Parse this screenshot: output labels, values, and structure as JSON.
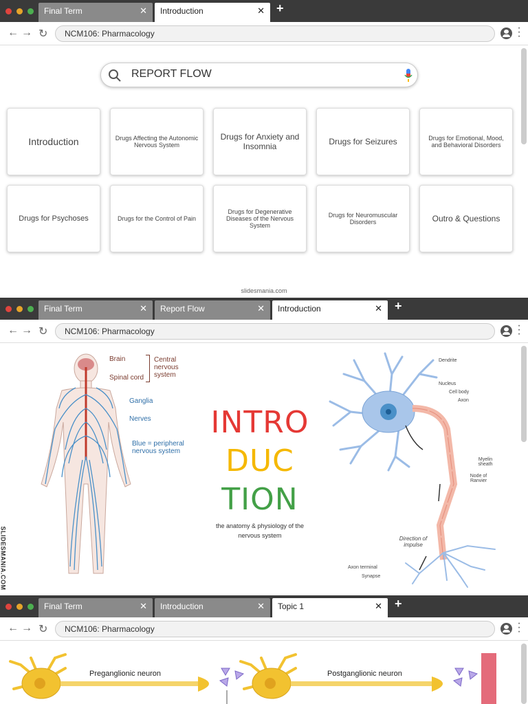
{
  "windows": [
    {
      "tabs": [
        {
          "label": "Final Term",
          "active": false
        },
        {
          "label": "Introduction",
          "active": true
        }
      ],
      "url": "NCM106: Pharmacology",
      "search_text": "REPORT FLOW",
      "cards": [
        "Introduction",
        "Drugs Affecting the Autonomic Nervous System",
        "Drugs for Anxiety and Insomnia",
        "Drugs for Seizures",
        "Drugs for Emotional, Mood, and Behavioral Disorders",
        "Drugs for Psychoses",
        "Drugs for the Control of Pain",
        "Drugs for Degenerative Diseases of the Nervous System",
        "Drugs for Neuromuscular Disorders",
        "Outro & Questions"
      ],
      "footer": "slidesmania.com"
    },
    {
      "tabs": [
        {
          "label": "Final Term",
          "active": false
        },
        {
          "label": "Report Flow",
          "active": false
        },
        {
          "label": "Introduction",
          "active": true
        }
      ],
      "url": "NCM106: Pharmacology",
      "title_lines": [
        "INTRO",
        "DUC",
        "TION"
      ],
      "subtitle": "the anatomy & physiology of the nervous system",
      "watermark": "SLIDESMANIA.COM",
      "body_labels": {
        "brain": "Brain",
        "spinal_cord": "Spinal cord",
        "cns": "Central nervous system",
        "ganglia": "Ganglia",
        "nerves": "Nerves",
        "blue": "Blue = peripheral nervous system"
      },
      "neuron_labels": {
        "dendrite": "Dendrite",
        "nucleus": "Nucleus",
        "cell_body": "Cell body",
        "axon": "Axon",
        "myelin": "Myelin sheath",
        "node": "Node of Ranvier",
        "direction": "Direction of impulse",
        "axon_terminal": "Axon terminal",
        "synapse": "Synapse"
      }
    },
    {
      "tabs": [
        {
          "label": "Final Term",
          "active": false
        },
        {
          "label": "Introduction",
          "active": false
        },
        {
          "label": "Topic 1",
          "active": true
        }
      ],
      "url": "NCM106: Pharmacology",
      "labels": {
        "pre": "Preganglionic neuron",
        "post": "Postganglionic neuron"
      }
    }
  ],
  "colors": {
    "title_red": "#e53935",
    "title_yellow": "#f5b800",
    "title_green": "#43a047",
    "nerve_blue": "#4a90c8",
    "neuron_fill": "#a9c6ea",
    "myelin": "#f3b8a8",
    "axon_gold": "#f2c230"
  }
}
